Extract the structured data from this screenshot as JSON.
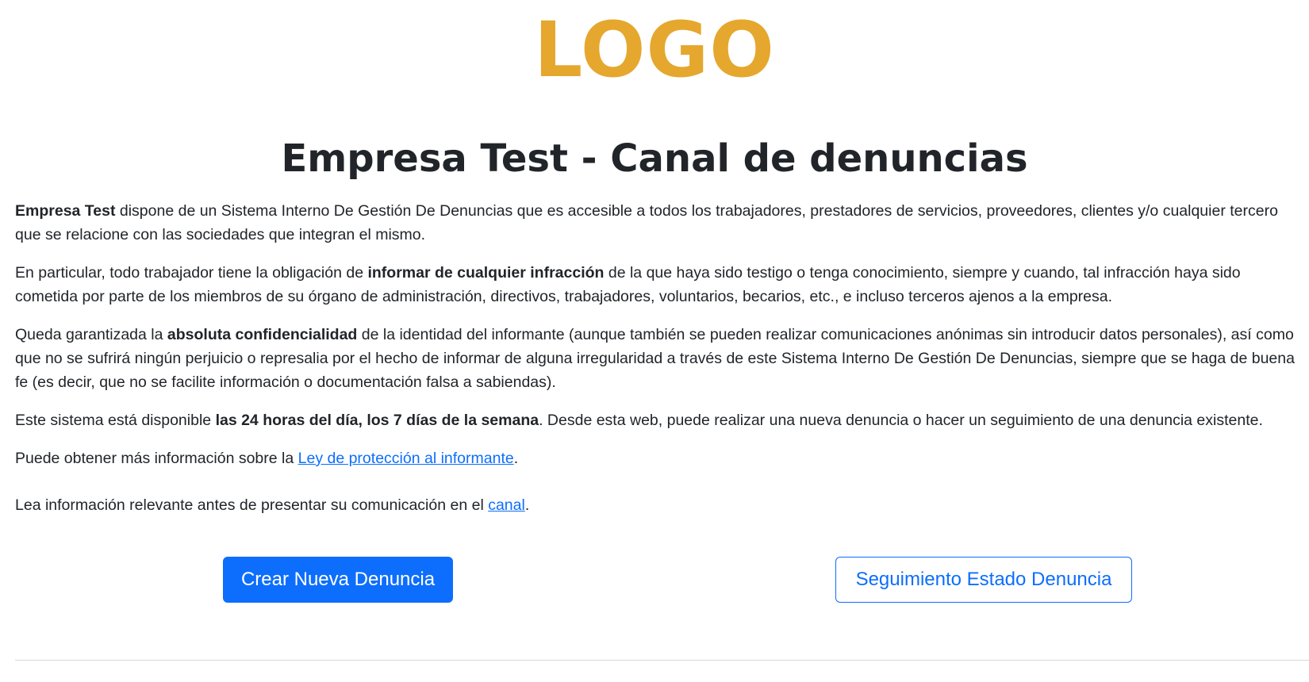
{
  "header": {
    "logo_text": "LOGO",
    "logo_color": "#e5a72d",
    "title": "Empresa Test - Canal de denuncias"
  },
  "intro": {
    "p1": {
      "company": "Empresa Test",
      "text": " dispone de un Sistema Interno De Gestión De Denuncias que es accesible a todos los trabajadores, prestadores de servicios, proveedores, clientes y/o cualquier tercero que se relacione con las sociedades que integran el mismo."
    },
    "p2": {
      "before": "En particular, todo trabajador tiene la obligación de ",
      "bold": "informar de cualquier infracción",
      "after": " de la que haya sido testigo o tenga conocimiento, siempre y cuando, tal infracción haya sido cometida por parte de los miembros de su órgano de administración, directivos, trabajadores, voluntarios, becarios, etc., e incluso terceros ajenos a la empresa."
    },
    "p3": {
      "before": "Queda garantizada la ",
      "bold": "absoluta confidencialidad",
      "after": " de la identidad del informante (aunque también se pueden realizar comunicaciones anónimas sin introducir datos personales), así como que no se sufrirá ningún perjuicio o represalia por el hecho de informar de alguna irregularidad a través de este Sistema Interno De Gestión De Denuncias, siempre que se haga de buena fe (es decir, que no se facilite información o documentación falsa a sabiendas)."
    },
    "p4": {
      "before": "Este sistema está disponible ",
      "bold": "las 24 horas del día, los 7 días de la semana",
      "after": ". Desde esta web, puede realizar una nueva denuncia o hacer un seguimiento de una denuncia existente."
    },
    "p5": {
      "before": "Puede obtener más información sobre la ",
      "link": "Ley de protección al informante",
      "after": "."
    },
    "p6": {
      "before": "Lea información relevante antes de presentar su comunicación en el ",
      "link": "canal",
      "after": "."
    }
  },
  "actions": {
    "create_label": "Crear Nueva Denuncia",
    "track_label": "Seguimiento Estado Denuncia"
  },
  "colors": {
    "primary": "#0d6efd",
    "text": "#212529"
  }
}
